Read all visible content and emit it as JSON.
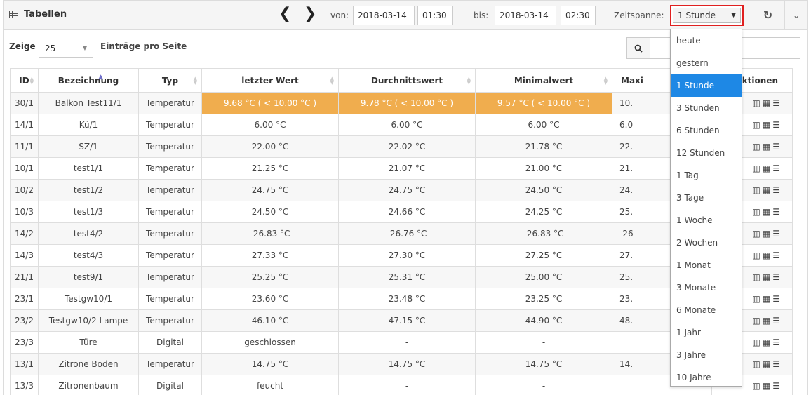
{
  "header": {
    "title": "Tabellen",
    "prev": "❮",
    "next": "❯",
    "von_label": "von:",
    "von_date": "2018-03-14",
    "von_time": "01:30",
    "bis_label": "bis:",
    "bis_date": "2018-03-14",
    "bis_time": "02:30",
    "zeitspanne_label": "Zeitspanne:",
    "zeitspanne_value": "1 Stunde",
    "refresh": "↻",
    "collapse": "⌄"
  },
  "toolbar": {
    "zeige": "Zeige",
    "per_page": "25",
    "eintraege": "Einträge pro Seite"
  },
  "table": {
    "columns": [
      "ID",
      "Bezeichnung",
      "Typ",
      "letzter Wert",
      "Durchnittswert",
      "Minimalwert",
      "Maxi",
      "Aktionen"
    ],
    "rows": [
      [
        "30/1",
        "Balkon Test11/1",
        "Temperatur",
        "9.68 °C ( < 10.00 °C )",
        "9.78 °C ( < 10.00 °C )",
        "9.57 °C ( < 10.00 °C )",
        "10."
      ],
      [
        "14/1",
        "Kü/1",
        "Temperatur",
        "6.00 °C",
        "6.00 °C",
        "6.00 °C",
        "6.0"
      ],
      [
        "11/1",
        "SZ/1",
        "Temperatur",
        "22.00 °C",
        "22.02 °C",
        "21.78 °C",
        "22."
      ],
      [
        "10/1",
        "test1/1",
        "Temperatur",
        "21.25 °C",
        "21.07 °C",
        "21.00 °C",
        "21."
      ],
      [
        "10/2",
        "test1/2",
        "Temperatur",
        "24.75 °C",
        "24.75 °C",
        "24.50 °C",
        "24."
      ],
      [
        "10/3",
        "test1/3",
        "Temperatur",
        "24.50 °C",
        "24.66 °C",
        "24.25 °C",
        "25."
      ],
      [
        "14/2",
        "test4/2",
        "Temperatur",
        "-26.83 °C",
        "-26.76 °C",
        "-26.83 °C",
        "-26"
      ],
      [
        "14/3",
        "test4/3",
        "Temperatur",
        "27.33 °C",
        "27.30 °C",
        "27.25 °C",
        "27."
      ],
      [
        "21/1",
        "test9/1",
        "Temperatur",
        "25.25 °C",
        "25.31 °C",
        "25.00 °C",
        "25."
      ],
      [
        "23/1",
        "Testgw10/1",
        "Temperatur",
        "23.60 °C",
        "23.48 °C",
        "23.25 °C",
        "23."
      ],
      [
        "23/2",
        "Testgw10/2 Lampe",
        "Temperatur",
        "46.10 °C",
        "47.15 °C",
        "44.90 °C",
        "48."
      ],
      [
        "23/3",
        "Türe",
        "Digital",
        "geschlossen",
        "-",
        "-",
        ""
      ],
      [
        "13/1",
        "Zitrone Boden",
        "Temperatur",
        "14.75 °C",
        "14.75 °C",
        "14.75 °C",
        "14."
      ],
      [
        "13/3",
        "Zitronenbaum",
        "Digital",
        "feucht",
        "-",
        "-",
        ""
      ]
    ],
    "action_icons": "📊 ▦ ☰"
  },
  "dropdown": {
    "options": [
      "heute",
      "gestern",
      "1 Stunde",
      "3 Stunden",
      "6 Stunden",
      "12 Stunden",
      "1 Tag",
      "3 Tage",
      "1 Woche",
      "2 Wochen",
      "1 Monat",
      "3 Monate",
      "6 Monate",
      "1 Jahr",
      "3 Jahre",
      "10 Jahre"
    ],
    "selected": "1 Stunde"
  },
  "colors": {
    "warning": "#f0ad4e",
    "selected": "#1e88e5",
    "highlight_border": "#e02020"
  }
}
